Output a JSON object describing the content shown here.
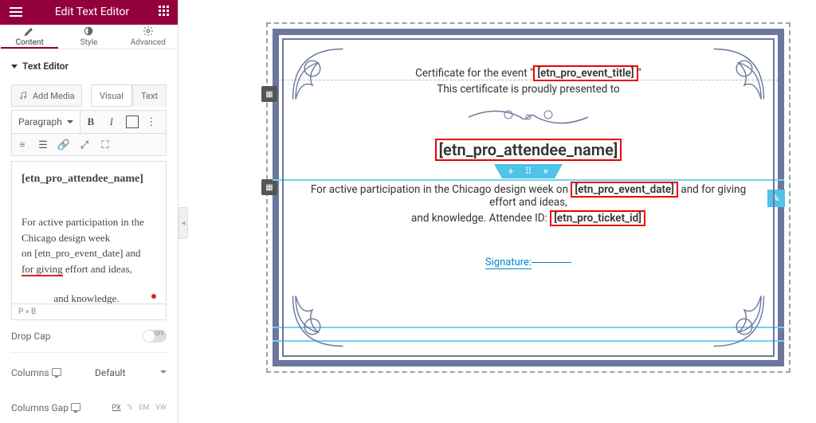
{
  "header": {
    "title": "Edit Text Editor"
  },
  "tabs": {
    "content": "Content",
    "style": "Style",
    "advanced": "Advanced"
  },
  "section": {
    "title": "Text Editor"
  },
  "toolbar": {
    "add_media": "Add Media",
    "visual": "Visual",
    "text": "Text",
    "paragraph": "Paragraph"
  },
  "rte": {
    "name": "[etn_pro_attendee_name]",
    "line1": "For active participation in the",
    "line2": "Chicago design week",
    "line3_a": "on [etn_pro_event_date] and",
    "line4_a": "for giving",
    "line4_b": " effort and ideas,",
    "line5": "and knowledge."
  },
  "path": "P » B",
  "drop_cap": {
    "label": "Drop Cap"
  },
  "columns": {
    "label": "Columns",
    "value": "Default"
  },
  "columns_gap": {
    "label": "Columns Gap",
    "units": [
      "PX",
      "%",
      "EM",
      "VW"
    ]
  },
  "cert": {
    "l1a": "Certificate for the event \"",
    "l1b": "[etn_pro_event_title]",
    "l1c": "\"",
    "l2": "This certificate is proudly presented to",
    "name": "[etn_pro_attendee_name]",
    "body_a": "For active participation in the Chicago design week on ",
    "body_b": "[etn_pro_event_date]",
    "body_c": " and for giving effort and ideas,",
    "body2_a": "and knowledge. Attendee ID: ",
    "body2_b": "[etn_pro_ticket_id]",
    "sig": "Signature:"
  }
}
